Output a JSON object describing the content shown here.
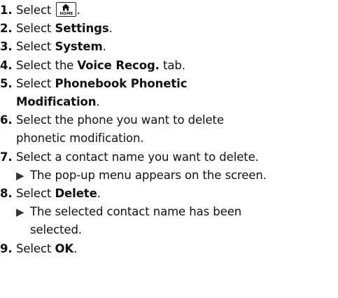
{
  "steps": [
    {
      "num": "1.",
      "pre": "Select ",
      "icon": "home-icon",
      "icon_label": "HOME",
      "post": "."
    },
    {
      "num": "2.",
      "pre": "Select ",
      "bold": "Settings",
      "post": "."
    },
    {
      "num": "3.",
      "pre": "Select ",
      "bold": "System",
      "post": "."
    },
    {
      "num": "4.",
      "pre": "Select the ",
      "bold": "Voice Recog.",
      "post": " tab."
    },
    {
      "num": "5.",
      "pre": "Select ",
      "bold1": "Phonebook Phonetic",
      "bold2": "Modification",
      "post": "."
    },
    {
      "num": "6.",
      "line1": "Select the phone you want to delete",
      "line2": "phonetic modification."
    },
    {
      "num": "7.",
      "text": "Select a contact name you want to delete.",
      "sub": "The pop-up menu appears on the screen."
    },
    {
      "num": "8.",
      "pre": "Select ",
      "bold": "Delete",
      "post": ".",
      "sub1": "The selected contact name has been",
      "sub2": "selected."
    },
    {
      "num": "9.",
      "pre": "Select ",
      "bold": "OK",
      "post": "."
    }
  ]
}
